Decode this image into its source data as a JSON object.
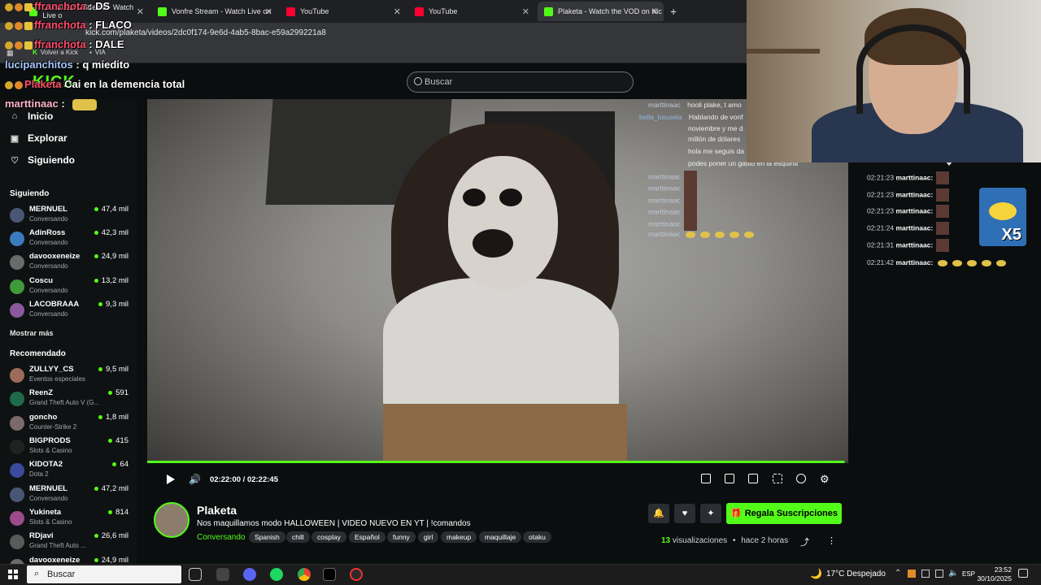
{
  "browser": {
    "tabs": [
      {
        "label": "brunboschh Stream - Watch Live o",
        "icon_color": "#53fc18"
      },
      {
        "label": "Vonfre Stream - Watch Live on",
        "icon_color": "#53fc18"
      },
      {
        "label": "YouTube",
        "icon_color": "#ff0033"
      },
      {
        "label": "YouTube",
        "icon_color": "#ff0033"
      },
      {
        "label": "Plaketa - Watch the VOD on Kic",
        "icon_color": "#53fc18"
      }
    ],
    "url": "kick.com/plaketa/videos/2dc0f174-9e6d-4ab5-8bac-e59a299221a8",
    "bookmarks": [
      "Volver a Kick",
      "VIA"
    ]
  },
  "header": {
    "logo": "KICK",
    "search_placeholder": "Buscar"
  },
  "sidebar": {
    "nav": [
      {
        "label": "Inicio",
        "icon": "home-icon"
      },
      {
        "label": "Explorar",
        "icon": "compass-icon"
      },
      {
        "label": "Siguiendo",
        "icon": "heart-icon"
      }
    ],
    "following_title": "Siguiendo",
    "following": [
      {
        "name": "MERNUEL",
        "category": "Conversando",
        "viewers": "47,4 mil"
      },
      {
        "name": "AdinRoss",
        "category": "Conversando",
        "viewers": "42,3 mil"
      },
      {
        "name": "davooxeneize",
        "category": "Conversando",
        "viewers": "24,9 mil"
      },
      {
        "name": "Coscu",
        "category": "Conversando",
        "viewers": "13,2 mil"
      },
      {
        "name": "LACOBRAAA",
        "category": "Conversando",
        "viewers": "9,3 mil"
      }
    ],
    "show_more": "Mostrar más",
    "recommended_title": "Recomendado",
    "recommended": [
      {
        "name": "ZULLYY_CS",
        "category": "Eventos especiales",
        "viewers": "9,5 mil"
      },
      {
        "name": "ReenZ",
        "category": "Grand Theft Auto V (G...",
        "viewers": "591"
      },
      {
        "name": "goncho",
        "category": "Counter-Strike 2",
        "viewers": "1,8 mil"
      },
      {
        "name": "BIGPRODS",
        "category": "Slots & Casino",
        "viewers": "415"
      },
      {
        "name": "KIDOTA2",
        "category": "Dota 2",
        "viewers": "64"
      },
      {
        "name": "MERNUEL",
        "category": "Conversando",
        "viewers": "47,2 mil"
      },
      {
        "name": "Yukineta",
        "category": "Slots & Casino",
        "viewers": "814"
      },
      {
        "name": "RDjavi",
        "category": "Grand Theft Auto ...",
        "viewers": "26,6 mil"
      },
      {
        "name": "davooxeneize",
        "category": "",
        "viewers": "24,9 mil"
      }
    ]
  },
  "player": {
    "time": "02:22:00 / 02:22:45",
    "progress": 0.995,
    "overlay_chat": [
      {
        "user": "marttinaac",
        "text": "hooli plake, t amo"
      },
      {
        "user": "bella_bausela",
        "text": "Hablando de vonf"
      },
      {
        "user": "",
        "text": "noviembre y me d"
      },
      {
        "user": "",
        "text": "millón de dólares"
      },
      {
        "user": "",
        "text": "hola me seguis da"
      },
      {
        "user": "",
        "text": "podes poner un gatito en la esquina"
      },
      {
        "user": "marttinaac",
        "text": ""
      },
      {
        "user": "marttinaac",
        "text": ""
      },
      {
        "user": "marttinaac",
        "text": ""
      },
      {
        "user": "marttinaac",
        "text": ""
      },
      {
        "user": "marttinaac",
        "text": ""
      },
      {
        "user": "marttinaac",
        "text": ""
      }
    ]
  },
  "stream_info": {
    "name": "Plaketa",
    "title": "Nos maquillamos modo HALLOWEEN | VIDEO NUEVO EN YT | !comandos",
    "category": "Conversando",
    "tags": [
      "Spanish",
      "chill",
      "cosplay",
      "Español",
      "funny",
      "girl",
      "makeup",
      "maquillaje",
      "otaku"
    ],
    "gift_button": "Regala Suscripciones",
    "views_count": "13",
    "views_label": "visualizaciones",
    "age": "hace 2 horas"
  },
  "chat": [
    {
      "time": "02:21:23",
      "user": "marttinaac:"
    },
    {
      "time": "02:21:23",
      "user": "marttinaac:"
    },
    {
      "time": "02:21:23",
      "user": "marttinaac:"
    },
    {
      "time": "02:21:24",
      "user": "marttinaac:"
    },
    {
      "time": "02:21:31",
      "user": "marttinaac:"
    },
    {
      "time": "02:21:42",
      "user": "marttinaac:"
    }
  ],
  "chat_sticker_label": "X5",
  "stream_overlay_chat": [
    {
      "user": "ffranchota",
      "text": ": DS"
    },
    {
      "user": "ffranchota",
      "text": ": FLACO"
    },
    {
      "user": "ffranchota",
      "text": ": DALE"
    },
    {
      "user": "lucipanchitos",
      "text": ": q miedito"
    },
    {
      "user": "Plaketa",
      "text": "Cai en la demencia total"
    },
    {
      "user": "marttinaac",
      "text": ":"
    }
  ],
  "taskbar": {
    "search": "Buscar",
    "weather": "17°C  Despejado",
    "lang": "ESP",
    "time": "23:52",
    "date": "30/10/2025"
  }
}
